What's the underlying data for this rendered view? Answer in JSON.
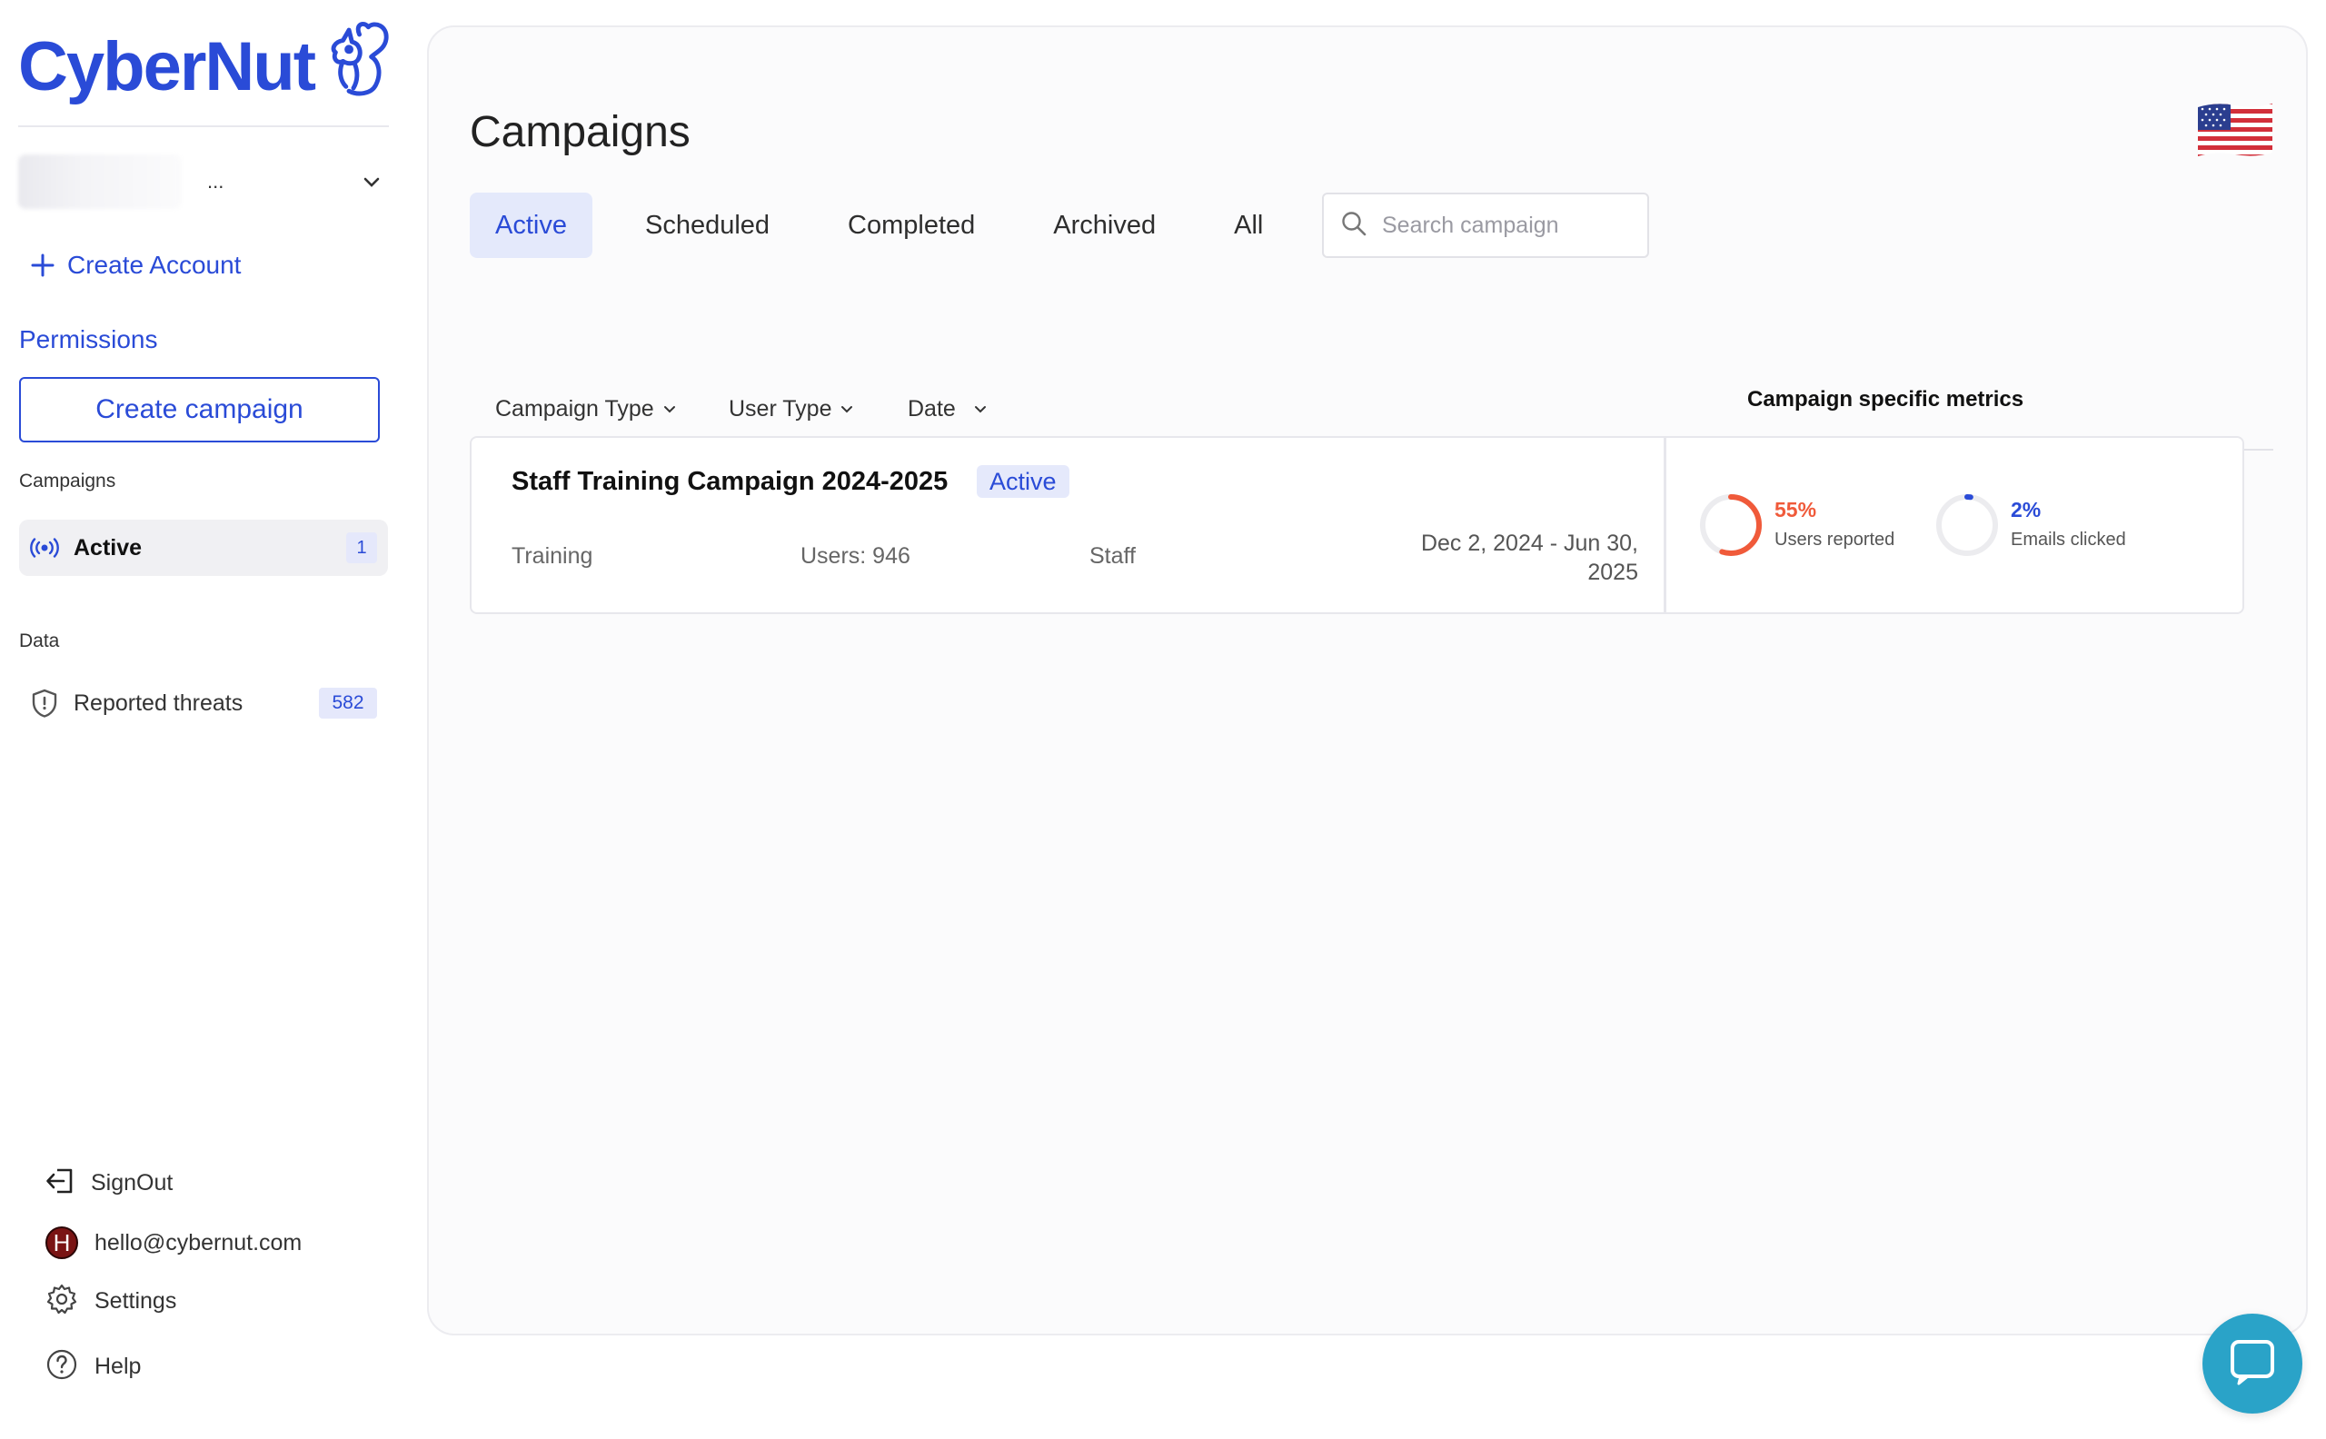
{
  "sidebar": {
    "logo_text": "CyberNut",
    "account": {
      "name": "...",
      "chevron": "chevron-down-icon"
    },
    "create_account_label": "Create Account",
    "permissions_label": "Permissions",
    "create_campaign_label": "Create campaign",
    "campaigns_section_label": "Campaigns",
    "active_item": {
      "label": "Active",
      "count": "1",
      "icon": "broadcast-icon"
    },
    "data_section_label": "Data",
    "reported_threats": {
      "label": "Reported threats",
      "count": "582",
      "icon": "shield-icon"
    },
    "signout_label": "SignOut",
    "user_email": "hello@cybernut.com",
    "avatar_letter": "H",
    "settings_label": "Settings",
    "help_label": "Help"
  },
  "main": {
    "title": "Campaigns",
    "tabs": [
      {
        "label": "Active",
        "active": true
      },
      {
        "label": "Scheduled",
        "active": false
      },
      {
        "label": "Completed",
        "active": false
      },
      {
        "label": "Archived",
        "active": false
      },
      {
        "label": "All",
        "active": false
      }
    ],
    "search_placeholder": "Search campaign",
    "filters": {
      "campaign_type": "Campaign Type",
      "user_type": "User Type",
      "date": "Date"
    },
    "metrics_header": "Campaign specific metrics",
    "campaigns": [
      {
        "title": "Staff Training Campaign 2024-2025",
        "status": "Active",
        "type": "Training",
        "users": "Users: 946",
        "audience": "Staff",
        "date_range": "Dec 2, 2024 - Jun 30, 2025",
        "metrics": [
          {
            "percent_label": "55%",
            "value": 0.55,
            "label": "Users reported",
            "color": "#f05a3a"
          },
          {
            "percent_label": "2%",
            "value": 0.02,
            "label": "Emails clicked",
            "color": "#2a4bd7"
          }
        ]
      }
    ]
  },
  "colors": {
    "brand": "#2a4bd7",
    "active_tab_bg": "#e4e9fb",
    "reported": "#f05a3a",
    "chat": "#2aa3c8"
  }
}
